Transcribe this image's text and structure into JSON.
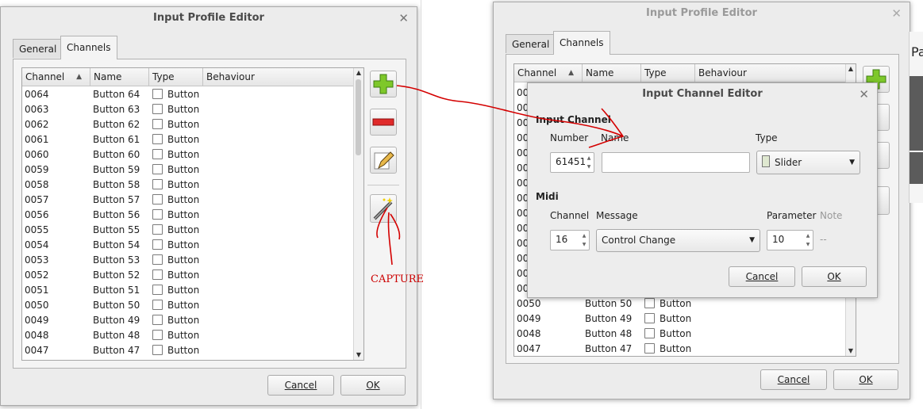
{
  "left_window": {
    "title": "Input Profile Editor",
    "tabs": [
      "General",
      "Channels"
    ],
    "columns": [
      "Channel",
      "Name",
      "Type",
      "Behaviour"
    ],
    "rows": [
      {
        "channel": "0064",
        "name": "Button 64",
        "type": "Button"
      },
      {
        "channel": "0063",
        "name": "Button 63",
        "type": "Button"
      },
      {
        "channel": "0062",
        "name": "Button 62",
        "type": "Button"
      },
      {
        "channel": "0061",
        "name": "Button 61",
        "type": "Button"
      },
      {
        "channel": "0060",
        "name": "Button 60",
        "type": "Button"
      },
      {
        "channel": "0059",
        "name": "Button 59",
        "type": "Button"
      },
      {
        "channel": "0058",
        "name": "Button 58",
        "type": "Button"
      },
      {
        "channel": "0057",
        "name": "Button 57",
        "type": "Button"
      },
      {
        "channel": "0056",
        "name": "Button 56",
        "type": "Button"
      },
      {
        "channel": "0055",
        "name": "Button 55",
        "type": "Button"
      },
      {
        "channel": "0054",
        "name": "Button 54",
        "type": "Button"
      },
      {
        "channel": "0053",
        "name": "Button 53",
        "type": "Button"
      },
      {
        "channel": "0052",
        "name": "Button 52",
        "type": "Button"
      },
      {
        "channel": "0051",
        "name": "Button 51",
        "type": "Button"
      },
      {
        "channel": "0050",
        "name": "Button 50",
        "type": "Button"
      },
      {
        "channel": "0049",
        "name": "Button 49",
        "type": "Button"
      },
      {
        "channel": "0048",
        "name": "Button 48",
        "type": "Button"
      },
      {
        "channel": "0047",
        "name": "Button 47",
        "type": "Button"
      }
    ],
    "cancel": "Cancel",
    "ok": "OK"
  },
  "annotation": {
    "text": "CAPTURE",
    "color": "#cc0000"
  },
  "right_window": {
    "title": "Input Profile Editor",
    "tabs": [
      "General",
      "Channels"
    ],
    "columns": [
      "Channel",
      "Name",
      "Type",
      "Behaviour"
    ],
    "hidden_channel_prefix": "00",
    "rows": [
      {
        "channel": "0050",
        "name": "Button 50",
        "type": "Button"
      },
      {
        "channel": "0049",
        "name": "Button 49",
        "type": "Button"
      },
      {
        "channel": "0048",
        "name": "Button 48",
        "type": "Button"
      },
      {
        "channel": "0047",
        "name": "Button 47",
        "type": "Button"
      }
    ],
    "cancel": "Cancel",
    "ok": "OK"
  },
  "channel_editor": {
    "title": "Input Channel Editor",
    "section_input": "Input Channel",
    "number_label": "Number",
    "number_value": "61451",
    "name_label": "Name",
    "name_value": "",
    "type_label": "Type",
    "type_value": "Slider",
    "section_midi": "Midi",
    "midi_channel_label": "Channel",
    "midi_channel_value": "16",
    "message_label": "Message",
    "message_value": "Control Change",
    "parameter_label": "Parameter",
    "parameter_value": "10",
    "note_label": "Note",
    "note_value": "--",
    "cancel": "Cancel",
    "ok": "OK"
  },
  "background_fragment": "Pa"
}
